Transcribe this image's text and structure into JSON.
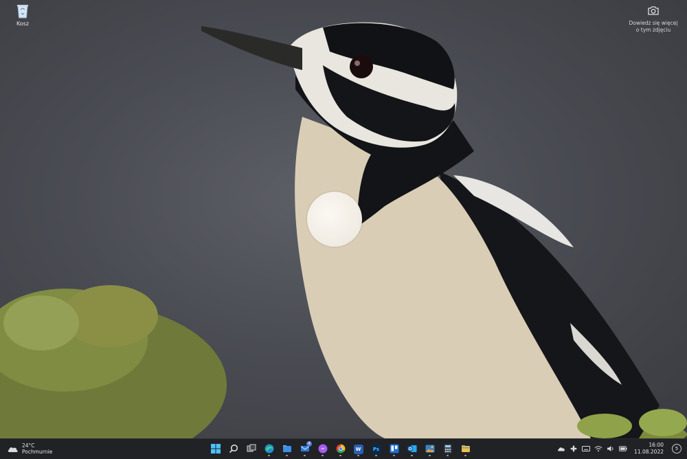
{
  "desktop": {
    "icons": [
      {
        "label": "Kosz",
        "icon": "recycle-bin-icon"
      }
    ],
    "spotlight": {
      "line1": "Dowiedz się więcej",
      "line2": "o tym zdjęciu",
      "icon": "camera-icon"
    }
  },
  "taskbar": {
    "weather": {
      "temp": "24°C",
      "condition": "Pochmurnie",
      "icon": "cloud-icon"
    },
    "apps": [
      {
        "name": "start",
        "icon": "windows-start-icon",
        "color": "#4cc2ff"
      },
      {
        "name": "search",
        "icon": "search-icon",
        "color": "#e6e6e6"
      },
      {
        "name": "task-view",
        "icon": "task-view-icon",
        "color": "#cfd3d8"
      },
      {
        "name": "edge",
        "icon": "edge-icon",
        "color": "#2bb673"
      },
      {
        "name": "file-manager",
        "icon": "folder-icon",
        "color": "#3d8ee6"
      },
      {
        "name": "mail",
        "icon": "mail-icon",
        "color": "#2f7be0",
        "badge": "4"
      },
      {
        "name": "messenger",
        "icon": "messenger-icon",
        "color": "#a55bf0"
      },
      {
        "name": "chrome",
        "icon": "chrome-icon",
        "color": "#34a853"
      },
      {
        "name": "word",
        "icon": "word-icon",
        "color": "#2b5fb4",
        "letter": "W"
      },
      {
        "name": "photoshop",
        "icon": "photoshop-icon",
        "color": "#0a2a4a",
        "letter": "Ps"
      },
      {
        "name": "trello",
        "icon": "trello-icon",
        "color": "#1f6fd0"
      },
      {
        "name": "outlook",
        "icon": "outlook-icon",
        "color": "#1d73c8"
      },
      {
        "name": "photos",
        "icon": "photos-icon",
        "color": "#d98a2b"
      },
      {
        "name": "calculator",
        "icon": "calculator-icon",
        "color": "#3b4653"
      },
      {
        "name": "explorer",
        "icon": "file-explorer-icon",
        "color": "#f0c043"
      }
    ],
    "tray": [
      "onedrive-icon",
      "slack-icon",
      "keyboard-icon",
      "wifi-icon",
      "volume-icon",
      "battery-icon"
    ],
    "time": "16:00",
    "date": "11.08.2022",
    "notifications": "5"
  }
}
